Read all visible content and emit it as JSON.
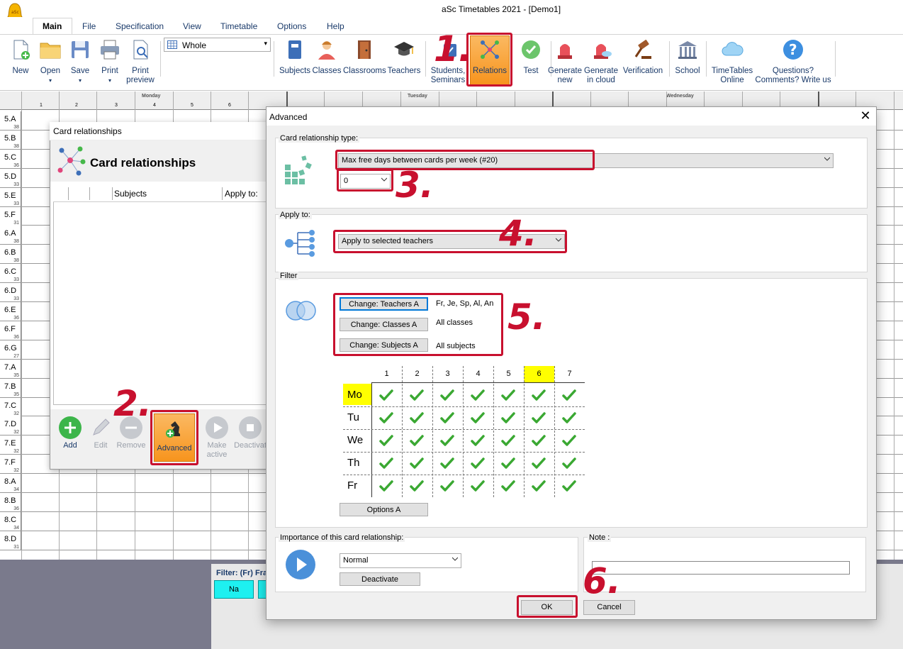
{
  "app": {
    "title": "aSc Timetables 2021  - [Demo1]"
  },
  "menu": {
    "tabs": [
      {
        "label": "Main"
      },
      {
        "label": "File"
      },
      {
        "label": "Specification"
      },
      {
        "label": "View"
      },
      {
        "label": "Timetable"
      },
      {
        "label": "Options"
      },
      {
        "label": "Help"
      }
    ]
  },
  "ribbon": {
    "new": "New",
    "open": "Open",
    "save": "Save",
    "print": "Print",
    "print_preview_1": "Print",
    "print_preview_2": "preview",
    "view_select": "Whole",
    "subjects": "Subjects",
    "classes": "Classes",
    "classrooms": "Classrooms",
    "teachers": "Teachers",
    "students_1": "Students,",
    "students_2": "Seminars",
    "relations": "Relations",
    "test": "Test",
    "generate_new_1": "Generate",
    "generate_new_2": "new",
    "generate_cloud_1": "Generate",
    "generate_cloud_2": "in cloud",
    "verification": "Verification",
    "school": "School",
    "online_1": "TimeTables",
    "online_2": "Online",
    "questions_1": "Questions?",
    "questions_2": "Comments? Write us"
  },
  "timetable": {
    "days": [
      "Monday",
      "Tuesday",
      "Wednesday"
    ],
    "periods": [
      "1",
      "2",
      "3",
      "4",
      "5",
      "6"
    ],
    "rows": [
      {
        "name": "5.A",
        "count": "38"
      },
      {
        "name": "5.B",
        "count": "38"
      },
      {
        "name": "5.C",
        "count": "36"
      },
      {
        "name": "5.D",
        "count": "33"
      },
      {
        "name": "5.E",
        "count": "33"
      },
      {
        "name": "5.F",
        "count": "31"
      },
      {
        "name": "6.A",
        "count": "38"
      },
      {
        "name": "6.B",
        "count": "38"
      },
      {
        "name": "6.C",
        "count": "33"
      },
      {
        "name": "6.D",
        "count": "33"
      },
      {
        "name": "6.E",
        "count": "36"
      },
      {
        "name": "6.F",
        "count": "36"
      },
      {
        "name": "6.G",
        "count": "27"
      },
      {
        "name": "7.A",
        "count": "35"
      },
      {
        "name": "7.B",
        "count": "35"
      },
      {
        "name": "7.C",
        "count": "32"
      },
      {
        "name": "7.D",
        "count": "32"
      },
      {
        "name": "7.E",
        "count": "32"
      },
      {
        "name": "7.F",
        "count": "32"
      },
      {
        "name": "8.A",
        "count": "34"
      },
      {
        "name": "8.B",
        "count": "36"
      },
      {
        "name": "8.C",
        "count": "34"
      },
      {
        "name": "8.D",
        "count": "31"
      }
    ],
    "filter_label": "Filter: (Fr) Fra",
    "card_label": "Na"
  },
  "card_relationships": {
    "window_title": "Card relationships",
    "heading": "Card relationships",
    "columns": [
      "",
      "",
      "Subjects",
      "Apply to:"
    ],
    "footer": {
      "add": "Add",
      "edit": "Edit",
      "remove": "Remove",
      "advanced": "Advanced",
      "make_active_1": "Make",
      "make_active_2": "active",
      "deactivate": "Deactivat"
    }
  },
  "advanced": {
    "title": "Advanced",
    "relationship_type_label": "Card relationship type:",
    "relationship_type_value": "Max free days between cards per week (#20)",
    "param_value": "0",
    "apply_to_label": "Apply to:",
    "apply_to_value": "Apply to selected teachers",
    "filter_label": "Filter",
    "filters": [
      {
        "button": "Change: Teachers A",
        "value": "Fr, Je, Sp, Al, An"
      },
      {
        "button": "Change: Classes A",
        "value": "All classes"
      },
      {
        "button": "Change: Subjects A",
        "value": "All subjects"
      }
    ],
    "periods": [
      "1",
      "2",
      "3",
      "4",
      "5",
      "6",
      "7"
    ],
    "highlighted_period": "6",
    "days": [
      "Mo",
      "Tu",
      "We",
      "Th",
      "Fr"
    ],
    "highlighted_day": "Mo",
    "all_allowed": true,
    "options_button": "Options A",
    "importance_label": "Importance of this card relationship:",
    "importance_value": "Normal",
    "deactivate_button": "Deactivate",
    "note_label": "Note :",
    "note_value": "",
    "ok": "OK",
    "cancel": "Cancel"
  },
  "annotations": [
    "1.",
    "2.",
    "3.",
    "4.",
    "5.",
    "6."
  ],
  "colors": {
    "annotation_red": "#c8102e",
    "highlight_orange": "#f7941d",
    "check_green": "#3aa832",
    "highlight_yellow": "#ffff00"
  }
}
